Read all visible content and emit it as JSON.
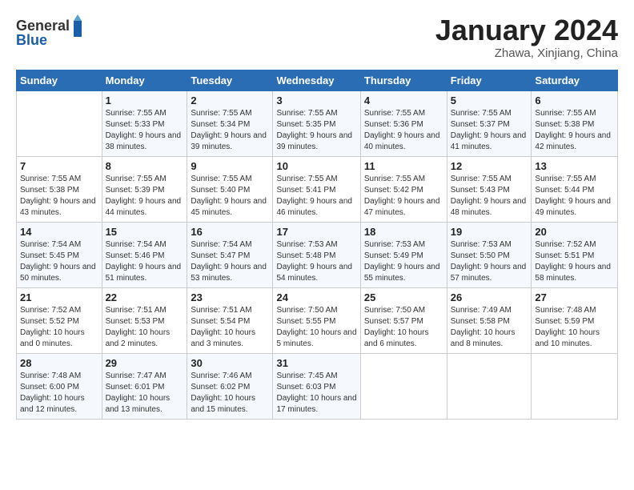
{
  "header": {
    "logo_line1": "General",
    "logo_line2": "Blue",
    "month": "January 2024",
    "location": "Zhawa, Xinjiang, China"
  },
  "weekdays": [
    "Sunday",
    "Monday",
    "Tuesday",
    "Wednesday",
    "Thursday",
    "Friday",
    "Saturday"
  ],
  "weeks": [
    [
      {
        "day": "",
        "sunrise": "",
        "sunset": "",
        "daylight": ""
      },
      {
        "day": "1",
        "sunrise": "Sunrise: 7:55 AM",
        "sunset": "Sunset: 5:33 PM",
        "daylight": "Daylight: 9 hours and 38 minutes."
      },
      {
        "day": "2",
        "sunrise": "Sunrise: 7:55 AM",
        "sunset": "Sunset: 5:34 PM",
        "daylight": "Daylight: 9 hours and 39 minutes."
      },
      {
        "day": "3",
        "sunrise": "Sunrise: 7:55 AM",
        "sunset": "Sunset: 5:35 PM",
        "daylight": "Daylight: 9 hours and 39 minutes."
      },
      {
        "day": "4",
        "sunrise": "Sunrise: 7:55 AM",
        "sunset": "Sunset: 5:36 PM",
        "daylight": "Daylight: 9 hours and 40 minutes."
      },
      {
        "day": "5",
        "sunrise": "Sunrise: 7:55 AM",
        "sunset": "Sunset: 5:37 PM",
        "daylight": "Daylight: 9 hours and 41 minutes."
      },
      {
        "day": "6",
        "sunrise": "Sunrise: 7:55 AM",
        "sunset": "Sunset: 5:38 PM",
        "daylight": "Daylight: 9 hours and 42 minutes."
      }
    ],
    [
      {
        "day": "7",
        "sunrise": "Sunrise: 7:55 AM",
        "sunset": "Sunset: 5:38 PM",
        "daylight": "Daylight: 9 hours and 43 minutes."
      },
      {
        "day": "8",
        "sunrise": "Sunrise: 7:55 AM",
        "sunset": "Sunset: 5:39 PM",
        "daylight": "Daylight: 9 hours and 44 minutes."
      },
      {
        "day": "9",
        "sunrise": "Sunrise: 7:55 AM",
        "sunset": "Sunset: 5:40 PM",
        "daylight": "Daylight: 9 hours and 45 minutes."
      },
      {
        "day": "10",
        "sunrise": "Sunrise: 7:55 AM",
        "sunset": "Sunset: 5:41 PM",
        "daylight": "Daylight: 9 hours and 46 minutes."
      },
      {
        "day": "11",
        "sunrise": "Sunrise: 7:55 AM",
        "sunset": "Sunset: 5:42 PM",
        "daylight": "Daylight: 9 hours and 47 minutes."
      },
      {
        "day": "12",
        "sunrise": "Sunrise: 7:55 AM",
        "sunset": "Sunset: 5:43 PM",
        "daylight": "Daylight: 9 hours and 48 minutes."
      },
      {
        "day": "13",
        "sunrise": "Sunrise: 7:55 AM",
        "sunset": "Sunset: 5:44 PM",
        "daylight": "Daylight: 9 hours and 49 minutes."
      }
    ],
    [
      {
        "day": "14",
        "sunrise": "Sunrise: 7:54 AM",
        "sunset": "Sunset: 5:45 PM",
        "daylight": "Daylight: 9 hours and 50 minutes."
      },
      {
        "day": "15",
        "sunrise": "Sunrise: 7:54 AM",
        "sunset": "Sunset: 5:46 PM",
        "daylight": "Daylight: 9 hours and 51 minutes."
      },
      {
        "day": "16",
        "sunrise": "Sunrise: 7:54 AM",
        "sunset": "Sunset: 5:47 PM",
        "daylight": "Daylight: 9 hours and 53 minutes."
      },
      {
        "day": "17",
        "sunrise": "Sunrise: 7:53 AM",
        "sunset": "Sunset: 5:48 PM",
        "daylight": "Daylight: 9 hours and 54 minutes."
      },
      {
        "day": "18",
        "sunrise": "Sunrise: 7:53 AM",
        "sunset": "Sunset: 5:49 PM",
        "daylight": "Daylight: 9 hours and 55 minutes."
      },
      {
        "day": "19",
        "sunrise": "Sunrise: 7:53 AM",
        "sunset": "Sunset: 5:50 PM",
        "daylight": "Daylight: 9 hours and 57 minutes."
      },
      {
        "day": "20",
        "sunrise": "Sunrise: 7:52 AM",
        "sunset": "Sunset: 5:51 PM",
        "daylight": "Daylight: 9 hours and 58 minutes."
      }
    ],
    [
      {
        "day": "21",
        "sunrise": "Sunrise: 7:52 AM",
        "sunset": "Sunset: 5:52 PM",
        "daylight": "Daylight: 10 hours and 0 minutes."
      },
      {
        "day": "22",
        "sunrise": "Sunrise: 7:51 AM",
        "sunset": "Sunset: 5:53 PM",
        "daylight": "Daylight: 10 hours and 2 minutes."
      },
      {
        "day": "23",
        "sunrise": "Sunrise: 7:51 AM",
        "sunset": "Sunset: 5:54 PM",
        "daylight": "Daylight: 10 hours and 3 minutes."
      },
      {
        "day": "24",
        "sunrise": "Sunrise: 7:50 AM",
        "sunset": "Sunset: 5:55 PM",
        "daylight": "Daylight: 10 hours and 5 minutes."
      },
      {
        "day": "25",
        "sunrise": "Sunrise: 7:50 AM",
        "sunset": "Sunset: 5:57 PM",
        "daylight": "Daylight: 10 hours and 6 minutes."
      },
      {
        "day": "26",
        "sunrise": "Sunrise: 7:49 AM",
        "sunset": "Sunset: 5:58 PM",
        "daylight": "Daylight: 10 hours and 8 minutes."
      },
      {
        "day": "27",
        "sunrise": "Sunrise: 7:48 AM",
        "sunset": "Sunset: 5:59 PM",
        "daylight": "Daylight: 10 hours and 10 minutes."
      }
    ],
    [
      {
        "day": "28",
        "sunrise": "Sunrise: 7:48 AM",
        "sunset": "Sunset: 6:00 PM",
        "daylight": "Daylight: 10 hours and 12 minutes."
      },
      {
        "day": "29",
        "sunrise": "Sunrise: 7:47 AM",
        "sunset": "Sunset: 6:01 PM",
        "daylight": "Daylight: 10 hours and 13 minutes."
      },
      {
        "day": "30",
        "sunrise": "Sunrise: 7:46 AM",
        "sunset": "Sunset: 6:02 PM",
        "daylight": "Daylight: 10 hours and 15 minutes."
      },
      {
        "day": "31",
        "sunrise": "Sunrise: 7:45 AM",
        "sunset": "Sunset: 6:03 PM",
        "daylight": "Daylight: 10 hours and 17 minutes."
      },
      {
        "day": "",
        "sunrise": "",
        "sunset": "",
        "daylight": ""
      },
      {
        "day": "",
        "sunrise": "",
        "sunset": "",
        "daylight": ""
      },
      {
        "day": "",
        "sunrise": "",
        "sunset": "",
        "daylight": ""
      }
    ]
  ]
}
